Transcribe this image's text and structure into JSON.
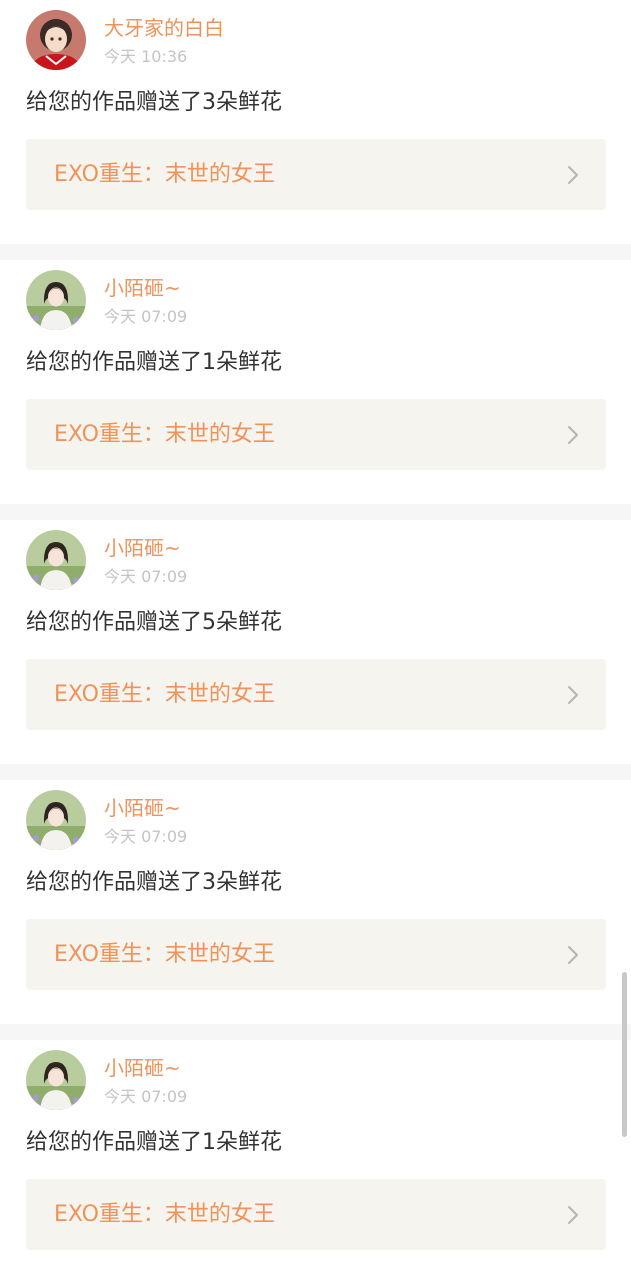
{
  "notifications": [
    {
      "username": "大牙家的白白",
      "time": "今天 10:36",
      "message": "给您的作品赠送了3朵鲜花",
      "work_title": "EXO重生：末世的女王",
      "avatar_icon": "anime-boy-red-avatar-icon"
    },
    {
      "username": "小陌砸~",
      "time": "今天 07:09",
      "message": "给您的作品赠送了1朵鲜花",
      "work_title": "EXO重生：末世的女王",
      "avatar_icon": "girl-flowers-avatar-icon"
    },
    {
      "username": "小陌砸~",
      "time": "今天 07:09",
      "message": "给您的作品赠送了5朵鲜花",
      "work_title": "EXO重生：末世的女王",
      "avatar_icon": "girl-flowers-avatar-icon"
    },
    {
      "username": "小陌砸~",
      "time": "今天 07:09",
      "message": "给您的作品赠送了3朵鲜花",
      "work_title": "EXO重生：末世的女王",
      "avatar_icon": "girl-flowers-avatar-icon"
    },
    {
      "username": "小陌砸~",
      "time": "今天 07:09",
      "message": "给您的作品赠送了1朵鲜花",
      "work_title": "EXO重生：末世的女王",
      "avatar_icon": "girl-flowers-avatar-icon"
    }
  ],
  "colors": {
    "accent": "#f0935a",
    "background": "#f6f6f6",
    "link_background": "#f5f4ee",
    "text": "#333333",
    "muted": "#c4c4c4"
  }
}
